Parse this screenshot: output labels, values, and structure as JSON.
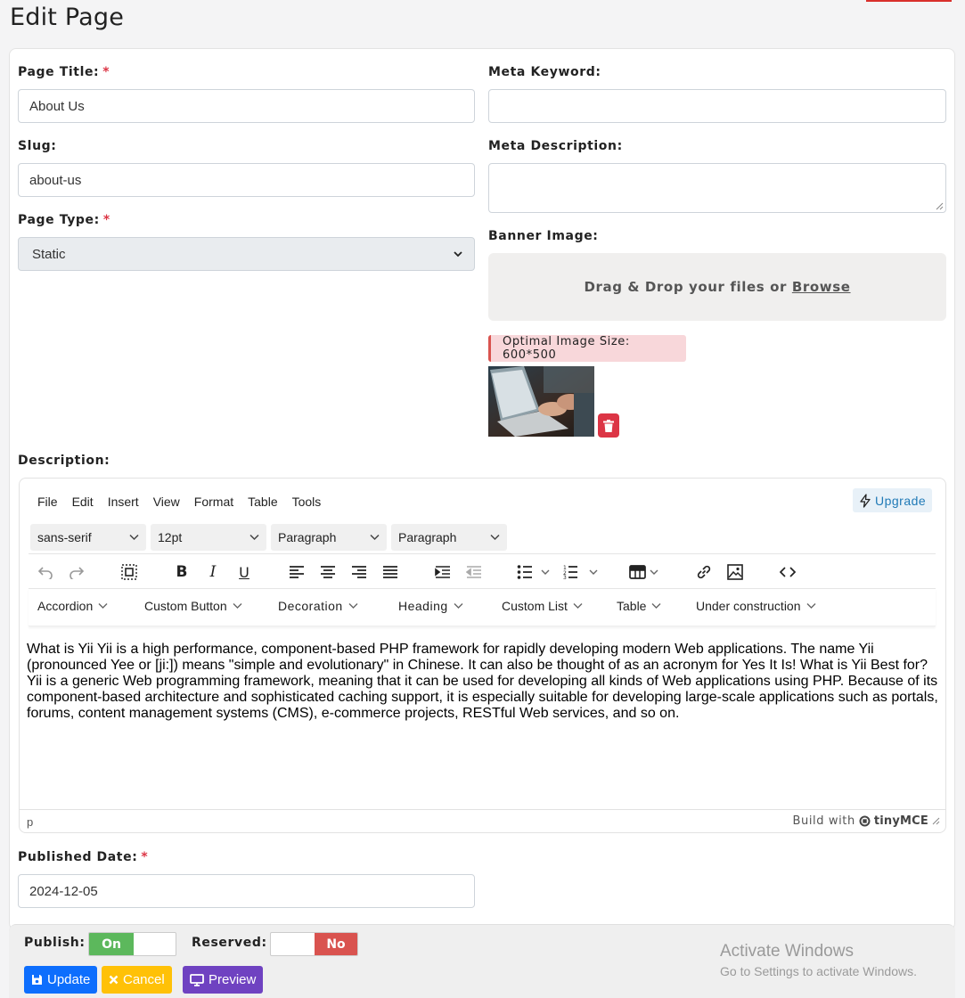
{
  "page_title": "Edit Page",
  "form": {
    "page_title_label": "Page Title:",
    "page_title_value": "About Us",
    "slug_label": "Slug:",
    "slug_value": "about-us",
    "page_type_label": "Page Type:",
    "page_type_value": "Static",
    "meta_keyword_label": "Meta Keyword:",
    "meta_keyword_value": "",
    "meta_description_label": "Meta Description:",
    "meta_description_value": "",
    "banner_label": "Banner Image:",
    "dropzone_text": "Drag & Drop your files or",
    "dropzone_link": "Browse",
    "image_hint": "Optimal Image Size: 600*500",
    "description_label": "Description:",
    "published_label": "Published Date:",
    "published_value": "2024-12-05",
    "required_mark": "*"
  },
  "editor": {
    "menu": [
      "File",
      "Edit",
      "Insert",
      "View",
      "Format",
      "Table",
      "Tools"
    ],
    "upgrade_label": "Upgrade",
    "font_family": "sans-serif",
    "font_size": "12pt",
    "block_format_1": "Paragraph",
    "block_format_2": "Paragraph",
    "custom_menus": [
      "Accordion",
      "Custom Button",
      "Decoration",
      "Heading",
      "Custom List",
      "Table",
      "Under construction"
    ],
    "content": "What is Yii Yii is a high performance, component-based PHP framework for rapidly developing modern Web applications. The name Yii (pronounced Yee or [ji:]) means \"simple and evolutionary\" in Chinese. It can also be thought of as an acronym for Yes It Is! What is Yii Best for? Yii is a generic Web programming framework, meaning that it can be used for developing all kinds of Web applications using PHP. Because of its component-based architecture and sophisticated caching support, it is especially suitable for developing large-scale applications such as portals, forums, content management systems (CMS), e-commerce projects, RESTful Web services, and so on.",
    "status_path": "p",
    "status_brand_prefix": "Build with",
    "status_brand": "tinyMCE"
  },
  "footer": {
    "publish_label": "Publish:",
    "publish_state": "On",
    "reserved_label": "Reserved:",
    "reserved_state": "No",
    "update_label": "Update",
    "cancel_label": "Cancel",
    "preview_label": "Preview"
  },
  "watermark": {
    "title": "Activate Windows",
    "subtitle": "Go to Settings to activate Windows."
  },
  "colors": {
    "required": "#dc3545",
    "on": "#5cb85c",
    "off": "#d9534f",
    "update": "#0d6efd",
    "cancel": "#ffc107",
    "preview": "#6f42c1",
    "upgrade": "#207ab7"
  }
}
